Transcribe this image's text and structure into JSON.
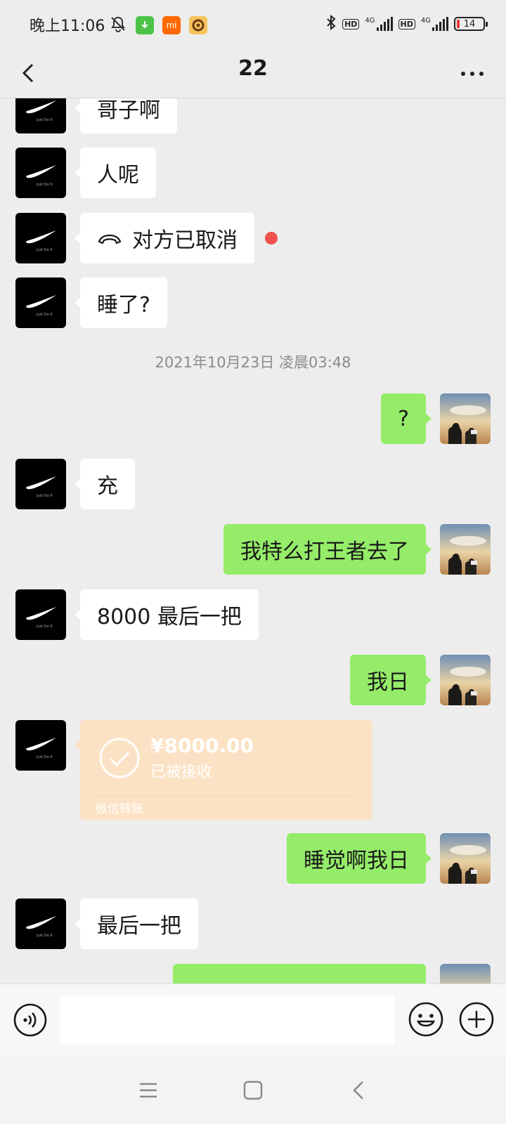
{
  "status_bar": {
    "time": "晚上11:06",
    "network_label_1": "4G",
    "network_label_2": "4G",
    "hd_1": "HD",
    "hd_2": "HD",
    "battery": "14",
    "left_icons": [
      "mute-bell-icon",
      "download-icon",
      "mi-icon",
      "app-icon"
    ],
    "right_icons": [
      "bluetooth-icon",
      "signal-icon",
      "signal-icon",
      "battery-icon"
    ]
  },
  "header": {
    "title": "22",
    "back_icon": "chevron-left-icon",
    "more_icon": "ellipsis-icon"
  },
  "messages": [
    {
      "side": "left",
      "text": "哥子啊"
    },
    {
      "side": "left",
      "text": "人呢"
    },
    {
      "side": "left",
      "text": "对方已取消",
      "icon": "hangup-icon",
      "unread_dot": true
    },
    {
      "side": "left",
      "text": "睡了?"
    },
    {
      "type": "timestamp",
      "text": "2021年10月23日 凌晨03:48"
    },
    {
      "side": "right",
      "text": "?"
    },
    {
      "side": "left",
      "text": "充"
    },
    {
      "side": "right",
      "text": "我特么打王者去了"
    },
    {
      "side": "left",
      "text": "8000 最后一把"
    },
    {
      "side": "right",
      "text": "我日"
    },
    {
      "side": "left",
      "type": "transfer",
      "amount": "¥8000.00",
      "status": "已被接收",
      "label": "微信转账"
    },
    {
      "side": "right",
      "text": "睡觉啊我日"
    },
    {
      "side": "left",
      "text": "最后一把"
    }
  ],
  "input_bar": {
    "placeholder": "",
    "voice_icon": "voice-icon",
    "emoji_icon": "emoji-icon",
    "plus_icon": "plus-icon"
  },
  "nav_bar": {
    "icons": [
      "menu-icon",
      "home-icon",
      "back-icon"
    ]
  },
  "colors": {
    "background": "#ededed",
    "my_bubble": "#95ec69",
    "their_bubble": "#ffffff",
    "transfer_card": "#fce2c4",
    "unread_dot": "#f0524f"
  }
}
